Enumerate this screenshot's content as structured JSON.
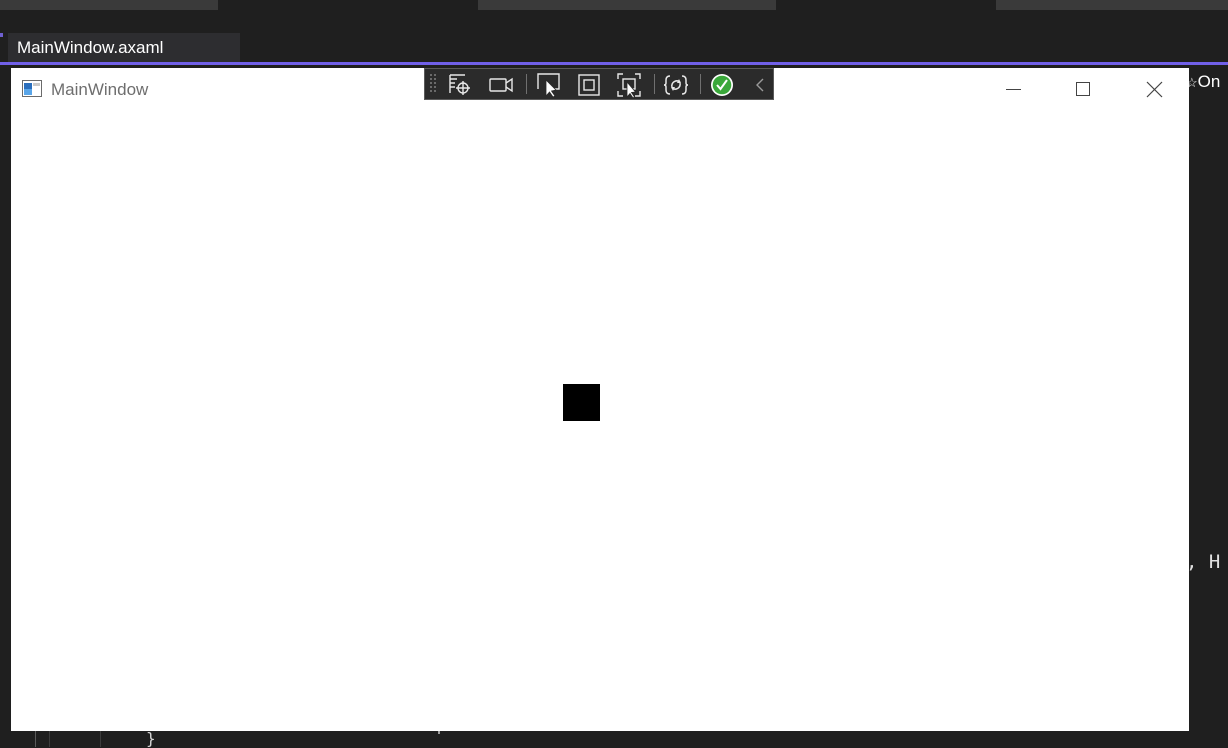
{
  "ide": {
    "document_tab": "MainWindow.axaml",
    "overflow_text": "On",
    "code_fragment": ", H",
    "bottom_brace": "}"
  },
  "window": {
    "title": "MainWindow",
    "buttons": {
      "minimize": "minimize-icon",
      "maximize": "maximize-icon",
      "close": "close-icon"
    }
  },
  "toolbar": {
    "icons": [
      "grip-icon",
      "select-element-icon",
      "display-layout-adorners-icon",
      "select-pointer-icon",
      "track-focus-icon",
      "show-bindings-failures-icon",
      "hot-reload-icon",
      "status-ok-icon",
      "collapse-chevron-icon"
    ]
  },
  "colors": {
    "ide_background": "#1f1f1f",
    "accent": "#7160e8",
    "window_background": "#ffffff",
    "status_ok": "#3aa83a"
  },
  "content": {
    "shape": "black-square",
    "shape_color": "#000000"
  }
}
